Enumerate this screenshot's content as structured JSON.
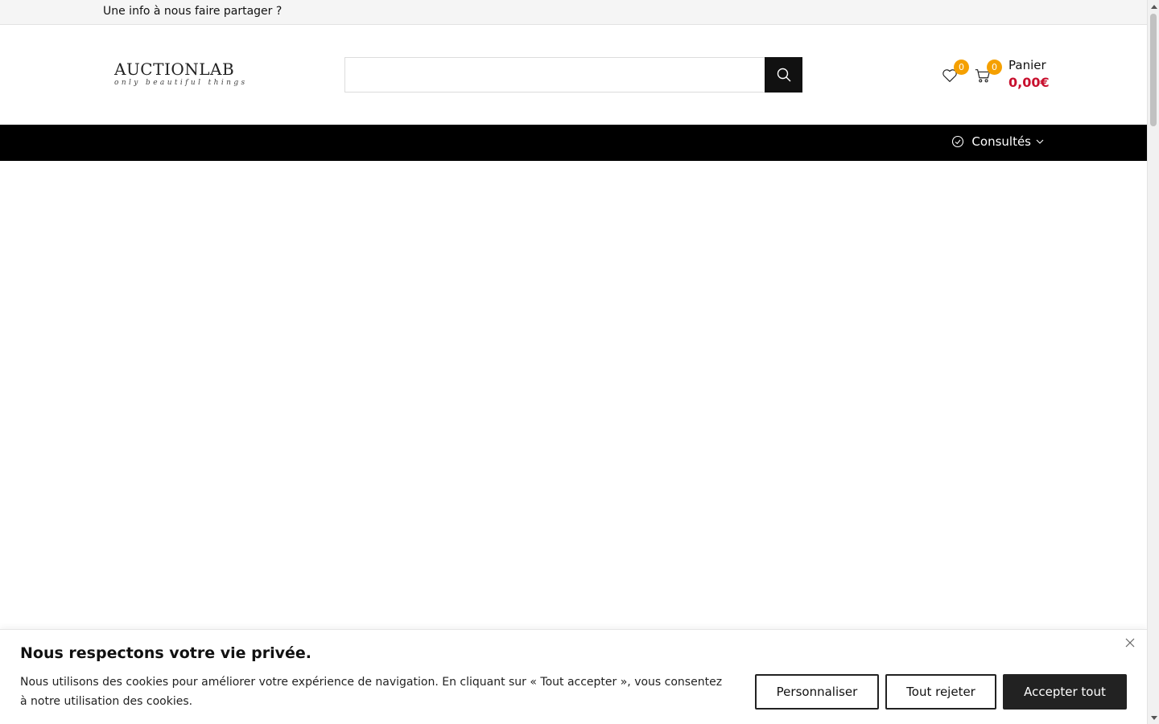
{
  "topbar": {
    "message": "Une info à nous faire partager ?"
  },
  "header": {
    "logo": {
      "name": "AUCTIONLAB",
      "tagline": "only beautiful things"
    },
    "search": {
      "placeholder": "",
      "value": "",
      "button_icon": "search-icon"
    },
    "wishlist": {
      "icon": "heart-icon",
      "count": "0"
    },
    "cart": {
      "icon": "cart-icon",
      "count": "0",
      "label": "Panier",
      "total": "0,00€"
    }
  },
  "nav": {
    "consultes": {
      "icon": "history-icon",
      "label": "Consultés",
      "chevron": "chevron-down-icon"
    }
  },
  "cookie_banner": {
    "title": "Nous respectons votre vie privée.",
    "text": "Nous utilisons des cookies pour améliorer votre expérience de navigation. En cliquant sur « Tout accepter », vous consentez à notre utilisation des cookies.",
    "buttons": {
      "customize": "Personnaliser",
      "reject": "Tout rejeter",
      "accept": "Accepter tout"
    },
    "close_icon": "close-icon"
  },
  "colors": {
    "badge": "#f5a000",
    "price": "#c8102e",
    "navbar": "#000000",
    "accept_button": "#222222"
  }
}
